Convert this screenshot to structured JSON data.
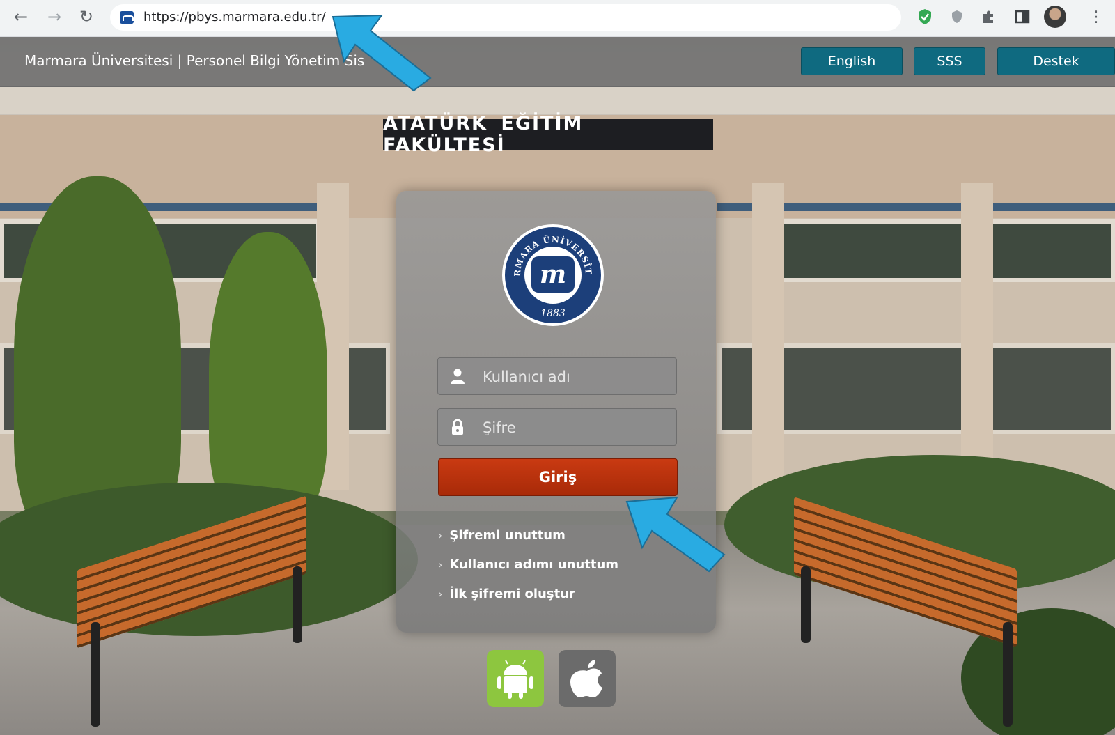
{
  "browser": {
    "url": "https://pbys.marmara.edu.tr/",
    "icons": [
      "back-icon",
      "forward-icon",
      "reload-icon",
      "shield-check-icon",
      "shield-icon",
      "puzzle-icon",
      "sidepanel-icon",
      "profile-avatar",
      "kebab-menu-icon"
    ]
  },
  "header": {
    "title": "Marmara Üniversitesi | Personel Bilgi Yönetim Sis",
    "buttons": [
      "English",
      "SSS",
      "Destek"
    ]
  },
  "background": {
    "sign_text": "ATATÜRK EĞİTİM FAKÜLTESİ"
  },
  "logo": {
    "arc_text": "MARMARA ÜNİVERSİTESİ",
    "year": "1883"
  },
  "login": {
    "username_placeholder": "Kullanıcı adı",
    "password_placeholder": "Şifre",
    "submit_label": "Giriş",
    "links": [
      "Şifremi unuttum",
      "Kullanıcı adımı unuttum",
      "İlk şifremi oluştur"
    ]
  },
  "apps": [
    "android-icon",
    "apple-icon"
  ],
  "colors": {
    "header_button": "#0f6a80",
    "login_button": "#b73110",
    "annotation_arrow": "#29abe2",
    "android_badge": "#8dc63f",
    "apple_badge": "#6b6b6b"
  }
}
